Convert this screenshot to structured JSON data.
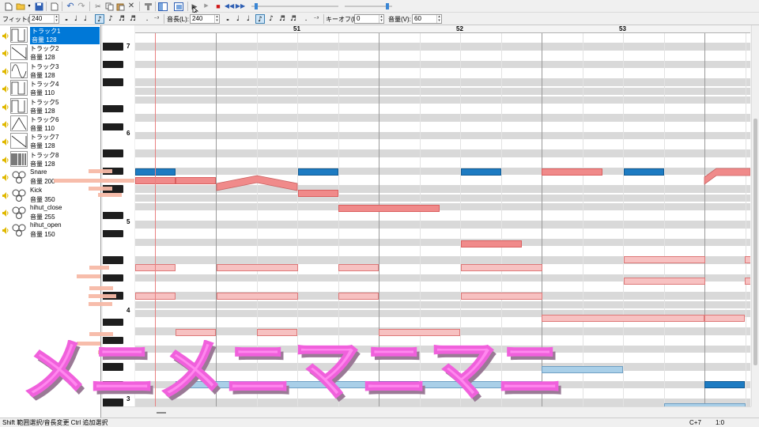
{
  "toolbar2": {
    "fit_label": "フィット(F):",
    "fit_value": "240",
    "length_label": "音長(L):",
    "length_value": "240",
    "keyoff_label": "キーオフ(K):",
    "keyoff_value": "0",
    "volume_label": "音量(V):",
    "volume_value": "60"
  },
  "tracks": [
    {
      "name": "トラック1",
      "volume": "音量 128",
      "selected": true,
      "wave": "square"
    },
    {
      "name": "トラック2",
      "volume": "音量 128",
      "wave": "saw"
    },
    {
      "name": "トラック3",
      "volume": "音量 128",
      "wave": "sine"
    },
    {
      "name": "トラック4",
      "volume": "音量 110",
      "wave": "square"
    },
    {
      "name": "トラック5",
      "volume": "音量 128",
      "wave": "square"
    },
    {
      "name": "トラック6",
      "volume": "音量 110",
      "wave": "triangle"
    },
    {
      "name": "トラック7",
      "volume": "音量 128",
      "wave": "saw"
    },
    {
      "name": "トラック8",
      "volume": "音量 128",
      "wave": "noise"
    },
    {
      "name": "Snare",
      "volume": "音量 200",
      "wave": "drum"
    },
    {
      "name": "Kick",
      "volume": "音量 350",
      "wave": "drum"
    },
    {
      "name": "hihut_close",
      "volume": "音量 255",
      "wave": "drum"
    },
    {
      "name": "hihut_open",
      "volume": "音量 150",
      "wave": "drum"
    }
  ],
  "ruler": {
    "bars": [
      "51",
      "52",
      "53"
    ]
  },
  "octaves": [
    "7",
    "6",
    "5",
    "4",
    "3"
  ],
  "status": {
    "hint": "Shift 範囲選択/音長変更  Ctrl 追加選択",
    "note": "C+7",
    "position": "1:0"
  },
  "caption": "メニメニマニマニ",
  "colors": {
    "selection": "#0078d7",
    "note_dark": "#f08a8a",
    "note_light": "#f7c1c1",
    "note_blue": "#1d7bc2",
    "note_light_blue": "#a9cfe8",
    "caption_fill": "#ff88ee",
    "caption_shadow": "#9a7a96"
  }
}
